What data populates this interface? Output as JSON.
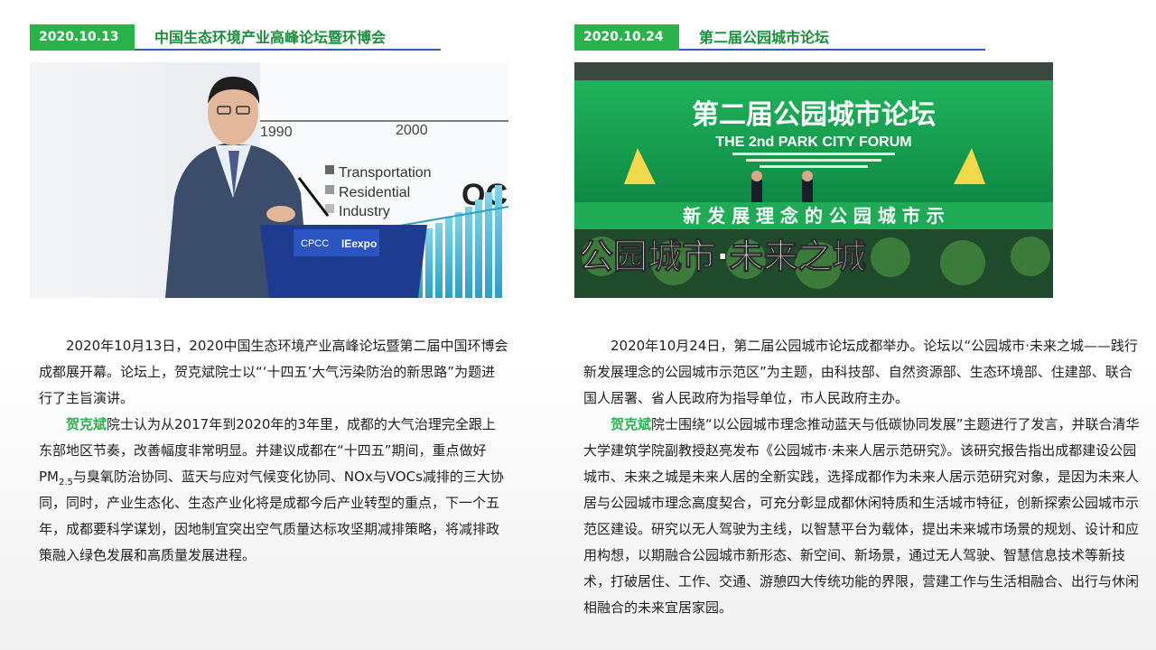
{
  "left": {
    "date": "2020.10.13",
    "title": "中国生态环境产业高峰论坛暨环博会",
    "photo_text": {
      "year1": "1990",
      "year2": "2000",
      "legend1": "Transportation",
      "legend2": "Residential",
      "legend3": "Industry",
      "big": "OC",
      "podium1": "CPCC",
      "podium2": "IEexpo"
    },
    "p1": "2020年10月13日，2020中国生态环境产业高峰论坛暨第二届中国环博会成都展开幕。论坛上，贺克斌院士以“‘十四五’大气污染防治的新思路”为题进行了主旨演讲。",
    "p2_name": "贺克斌",
    "p2_a": "院士认为从2017年到2020年的3年里，成都的大气治理完全跟上东部地区节奏，改善幅度非常明显。并建议成都在“十四五”期间，重点做好PM",
    "p2_sub": "2.5",
    "p2_b": "与臭氧防治协同、蓝天与应对气候变化协同、NOx与VOCs减排的三大协同，同时，产业生态化、生态产业化将是成都今后产业转型的重点，下一个五年，成都要科学谋划，因地制宜突出空气质量达标攻坚期减排策略，将减排政策融入绿色发展和高质量发展进程。"
  },
  "right": {
    "date": "2020.10.24",
    "title": "第二届公园城市论坛",
    "photo_text": {
      "banner_cn": "第二届公园城市论坛",
      "banner_en": "THE 2nd PARK CITY FORUM",
      "stage": "公园城市·未来之城",
      "screen": "新 发 展 理 念 的 公 园 城 市 示"
    },
    "p1": "2020年10月24日，第二届公园城市论坛成都举办。论坛以“公园城市·未来之城——践行新发展理念的公园城市示范区”为主题，由科技部、自然资源部、生态环境部、住建部、联合国人居署、省人民政府为指导单位，市人民政府主办。",
    "p2_name": "贺克斌",
    "p2_a": "院士围绕“以公园城市理念推动蓝天与低碳协同发展”主题进行了发言，并联合清华大学建筑学院副教授赵亮发布《公园城市·未来人居示范研究》。该研究报告指出成都建设公园城市、未来之城是未来人居的全新实践，选择成都作为未来人居示范研究对象，是因为未来人居与公园城市理念高度契合，可充分彰显成都休闲特质和生活城市特征，创新探索公园城市示范区建设。研究以无人驾驶为主线，以智慧平台为载体，提出未来城市场景的规划、设计和应用构想，以期融合公园城市新形态、新空间、新场景，通过无人驾驶、智慧信息技术等新技术，打破居住、工作、交通、游憩四大传统功能的界限，营建工作与生活相融合、出行与休闲相融合的未来宜居家园。"
  },
  "colors": {
    "accent_green": "#2ab34a",
    "title_green": "#1c8f3c",
    "underline_blue": "#2b5fb0"
  }
}
